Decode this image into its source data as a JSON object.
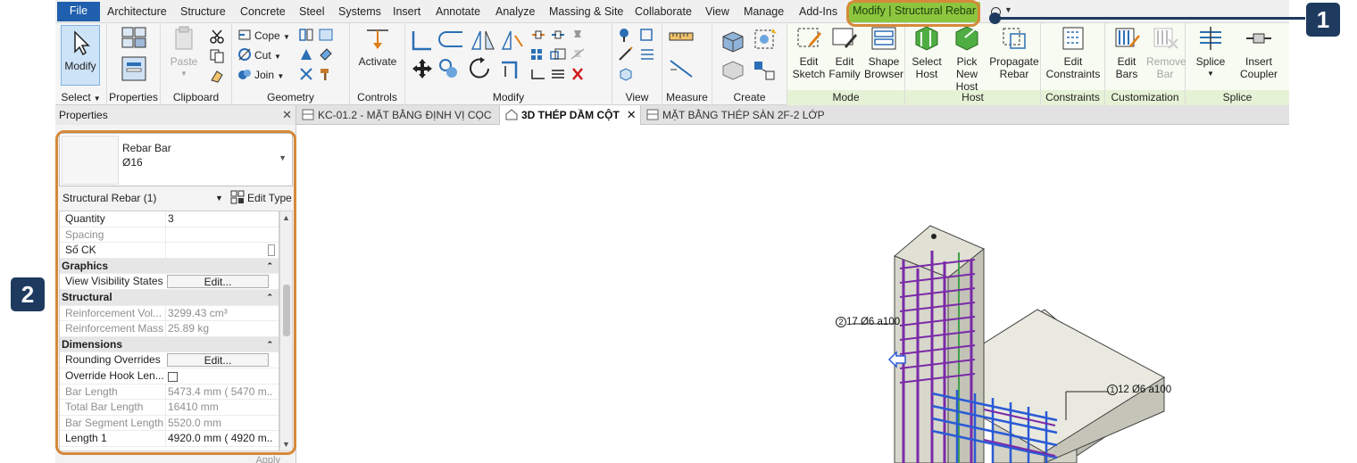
{
  "ribbon_tabs": [
    "File",
    "Architecture",
    "Structure",
    "Concrete",
    "Steel",
    "Systems",
    "Insert",
    "Annotate",
    "Analyze",
    "Massing & Site",
    "Collaborate",
    "View",
    "Manage",
    "Add-Ins",
    "Modify | Structural Rebar"
  ],
  "ribbon": {
    "select": {
      "modify_label": "Modify",
      "panel_label": "Select"
    },
    "properties": {
      "panel_label": "Properties"
    },
    "clipboard": {
      "paste_label": "Paste",
      "panel_label": "Clipboard"
    },
    "geometry": {
      "cope_label": "Cope",
      "cut_label": "Cut",
      "join_label": "Join",
      "panel_label": "Geometry"
    },
    "controls": {
      "activate_label": "Activate",
      "panel_label": "Controls"
    },
    "modify": {
      "panel_label": "Modify"
    },
    "view": {
      "panel_label": "View"
    },
    "measure": {
      "panel_label": "Measure"
    },
    "create": {
      "panel_label": "Create"
    },
    "mode": {
      "edit_sketch": "Edit\nSketch",
      "edit_family": "Edit\nFamily",
      "shape_browser": "Shape\nBrowser",
      "panel_label": "Mode"
    },
    "host": {
      "select_host": "Select\nHost",
      "pick_new_host": "Pick New\nHost",
      "propagate_rebar": "Propagate\nRebar",
      "panel_label": "Host"
    },
    "constraints": {
      "edit_constraints": "Edit\nConstraints",
      "panel_label": "Constraints"
    },
    "customization": {
      "edit_bars": "Edit\nBars",
      "remove_bar": "Remove\nBar",
      "panel_label": "Customization"
    },
    "splice": {
      "splice": "Splice",
      "insert_coupler": "Insert\nCoupler",
      "panel_label": "Splice"
    }
  },
  "properties": {
    "title": "Properties",
    "type_family": "Rebar Bar",
    "type_name": "Ø16",
    "filter": "Structural Rebar (1)",
    "edit_type": "Edit Type",
    "rows": [
      {
        "label": "Quantity",
        "value": "3"
      },
      {
        "label": "Spacing",
        "value": ""
      },
      {
        "label": "Số CK",
        "value": ""
      }
    ],
    "groups": {
      "graphics": "Graphics",
      "structural": "Structural",
      "dimensions": "Dimensions"
    },
    "graphics_rows": [
      {
        "label": "View Visibility States",
        "button": "Edit..."
      }
    ],
    "structural_rows": [
      {
        "label": "Reinforcement Vol...",
        "value": "3299.43 cm³"
      },
      {
        "label": "Reinforcement Mass",
        "value": "25.89 kg"
      }
    ],
    "dimensions_rows": [
      {
        "label": "Rounding Overrides",
        "button": "Edit..."
      },
      {
        "label": "Override Hook Len..."
      },
      {
        "label": "Bar Length",
        "value": "5473.4 mm ( 5470 m..."
      },
      {
        "label": "Total Bar Length",
        "value": "16410 mm"
      },
      {
        "label": "Bar Segment Length",
        "value": "5520.0 mm"
      },
      {
        "label": "Length 1",
        "value": "4920.0 mm ( 4920 m..."
      }
    ],
    "apply": "Apply"
  },
  "view_tabs": [
    {
      "label": "KC-01.2 - MẶT BẰNG ĐỊNH VỊ CỌC"
    },
    {
      "label": "3D THÉP DẦM CỘT"
    },
    {
      "label": "MẶT BẰNG THÉP SÀN 2F-2 LỚP"
    }
  ],
  "canvas": {
    "tag1_num": "2",
    "tag1_text": "17 Ø6 a100",
    "tag2_num": "1",
    "tag2_text": "12 Ø6 a100"
  },
  "callouts": [
    "1",
    "2"
  ]
}
